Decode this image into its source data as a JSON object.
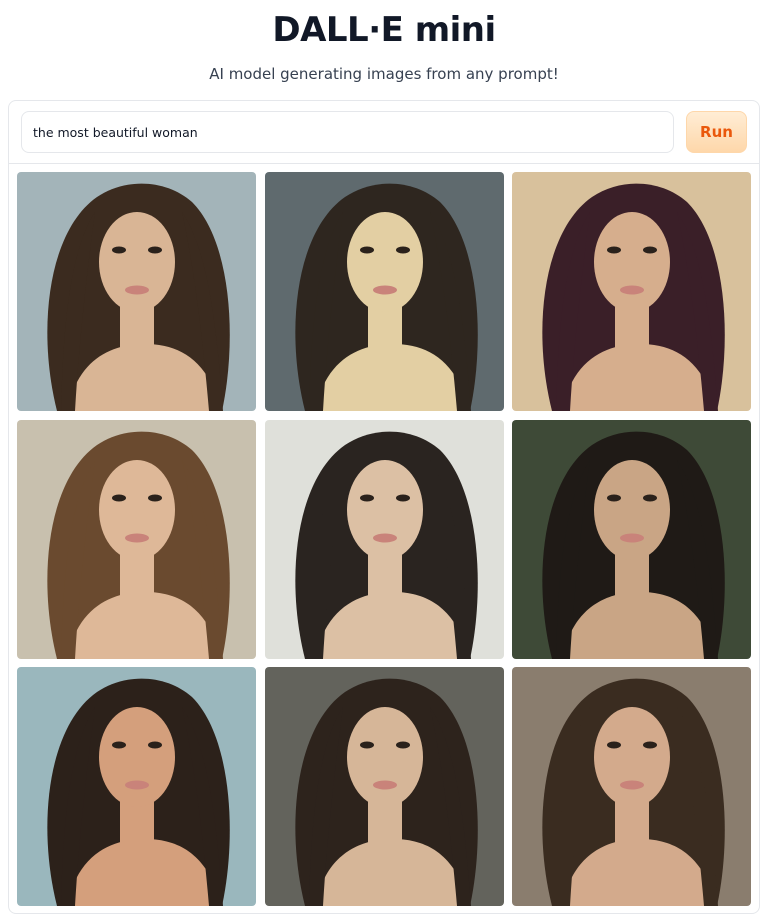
{
  "header": {
    "title": "DALL·E mini",
    "subtitle": "AI model generating images from any prompt!"
  },
  "prompt": {
    "value": "the most beautiful woman",
    "run_label": "Run"
  },
  "gallery": {
    "images": [
      {
        "bg": "#a3b4b9",
        "hair": "#3b2b1f",
        "skin": "#d9b595"
      },
      {
        "bg": "#5f6a6e",
        "hair": "#2e261f",
        "skin": "#e3cfa3"
      },
      {
        "bg": "#d8c19c",
        "hair": "#3a1f28",
        "skin": "#d6ae8d"
      },
      {
        "bg": "#c8c0ae",
        "hair": "#6a4a2f",
        "skin": "#deb898"
      },
      {
        "bg": "#dfe0da",
        "hair": "#2a2420",
        "skin": "#dcc0a4"
      },
      {
        "bg": "#3e4a37",
        "hair": "#1f1a16",
        "skin": "#c9a585"
      },
      {
        "bg": "#9ab7bd",
        "hair": "#2c211a",
        "skin": "#d49f7c"
      },
      {
        "bg": "#63635c",
        "hair": "#2d231c",
        "skin": "#d6b698"
      },
      {
        "bg": "#8a7d6e",
        "hair": "#3a2c20",
        "skin": "#d3aa8c"
      }
    ]
  }
}
